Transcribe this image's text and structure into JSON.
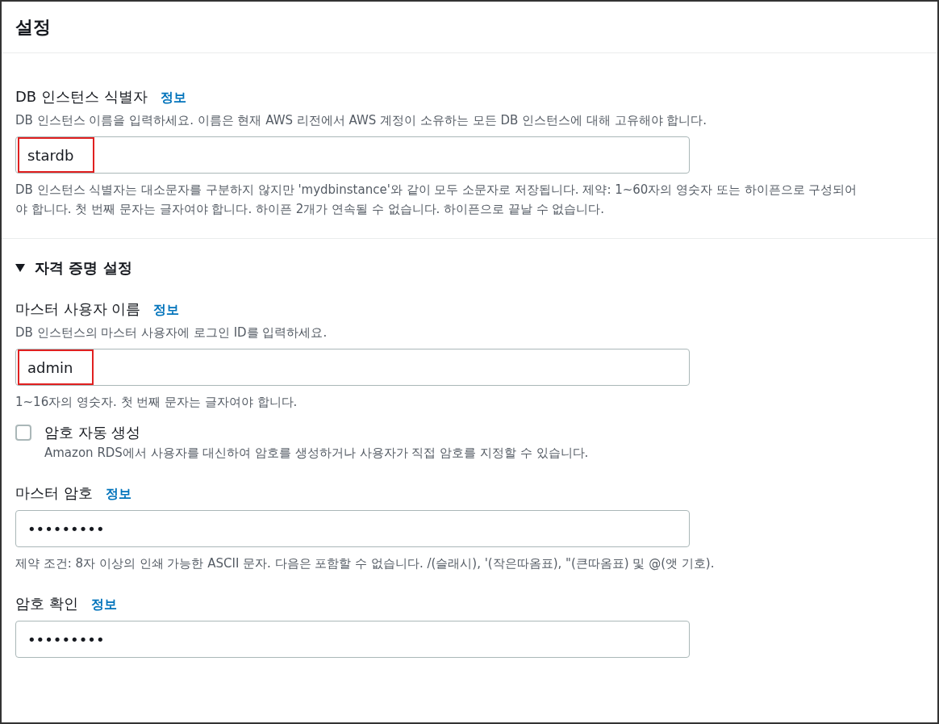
{
  "title": "설정",
  "fields": [
    {
      "label": "DB 인스턴스 식별자",
      "info": "정보",
      "description": "DB 인스턴스 이름을 입력하세요. 이름은 현재 AWS 리전에서 AWS 계정이 소유하는 모든 DB 인스턴스에 대해 고유해야 합니다.",
      "value": "stardb",
      "highlighted": true,
      "constraint": "DB 인스턴스 식별자는 대소문자를 구분하지 않지만 'mydbinstance'와 같이 모두 소문자로 저장됩니다. 제약: 1~60자의 영숫자 또는 하이픈으로 구성되어야 합니다. 첫 번째 문자는 글자여야 합니다. 하이픈 2개가 연속될 수 없습니다. 하이픈으로 끝날 수 없습니다."
    }
  ],
  "credentials": {
    "title": "자격 증명 설정",
    "expanded": true,
    "items": [
      {
        "kind": "field",
        "label": "마스터 사용자 이름",
        "info": "정보",
        "description": "DB 인스턴스의 마스터 사용자에 로그인 ID를 입력하세요.",
        "value": "admin",
        "highlighted": true,
        "constraint": "1~16자의 영숫자. 첫 번째 문자는 글자여야 합니다."
      },
      {
        "kind": "checkbox",
        "label": "암호 자동 생성",
        "checked": false,
        "description": "Amazon RDS에서 사용자를 대신하여 암호를 생성하거나 사용자가 직접 암호를 지정할 수 있습니다."
      },
      {
        "kind": "field",
        "label": "마스터 암호",
        "info": "정보",
        "value": "•••••••••",
        "highlighted": false,
        "constraint": "제약 조건: 8자 이상의 인쇄 가능한 ASCII 문자. 다음은 포함할 수 없습니다. /(슬래시), '(작은따옴표), \"(큰따옴표) 및 @(앳 기호)."
      },
      {
        "kind": "field",
        "label": "암호 확인",
        "info": "정보",
        "value": "•••••••••",
        "highlighted": false
      }
    ]
  }
}
